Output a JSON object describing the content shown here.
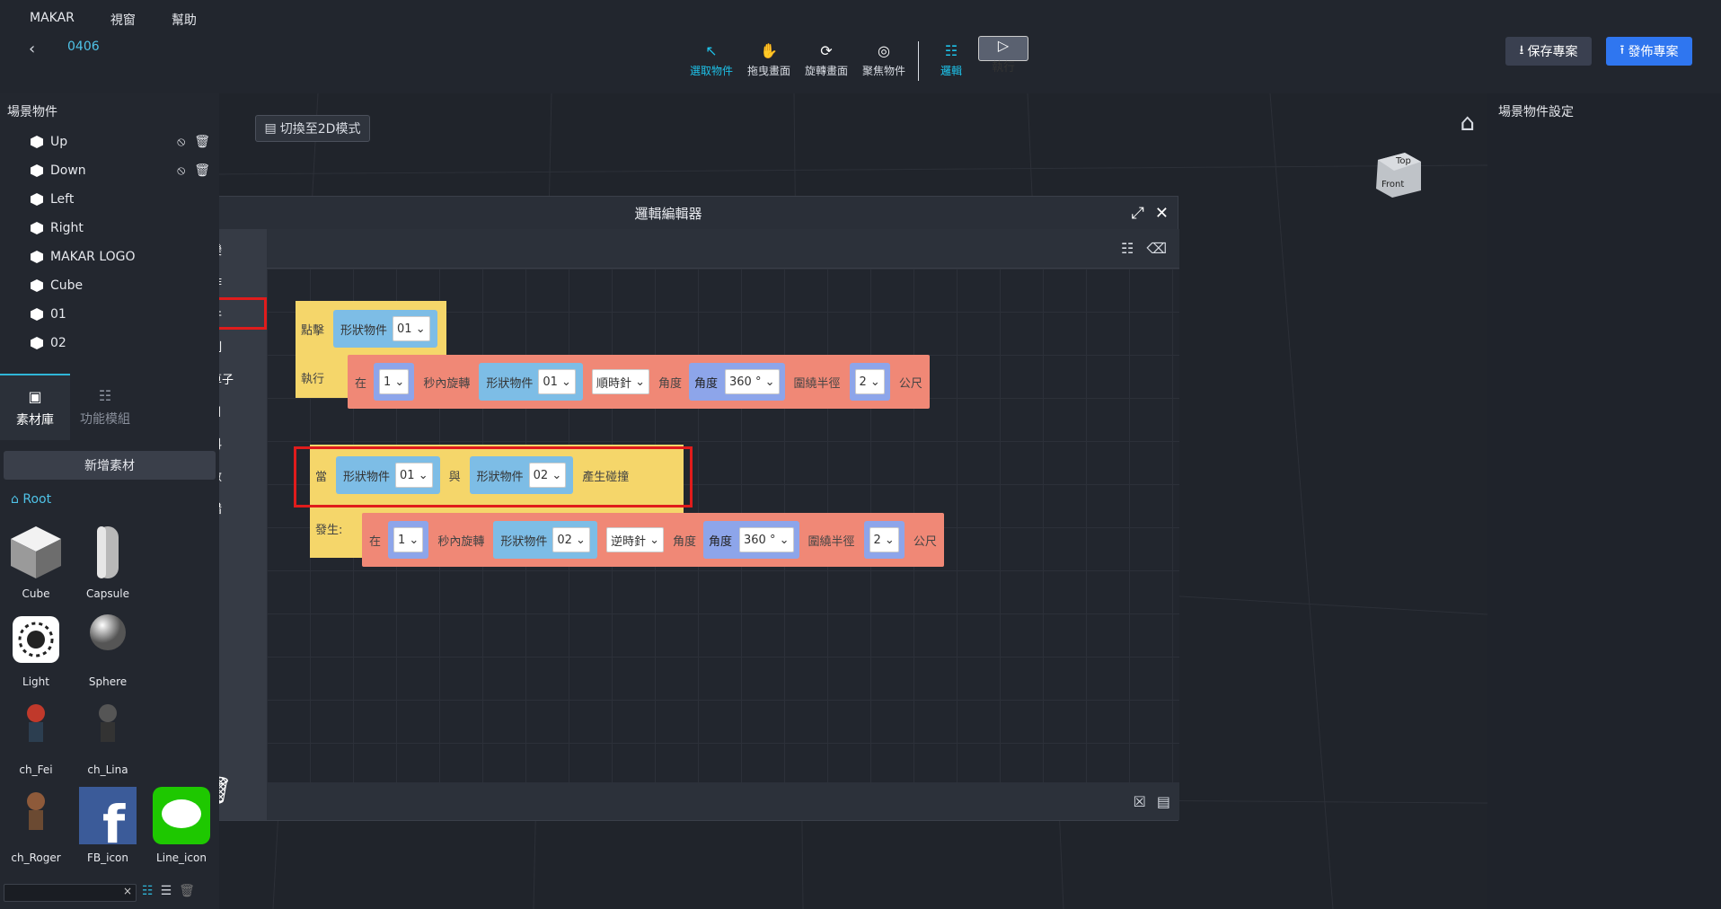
{
  "menu": [
    "MAKAR",
    "視窗",
    "幫助"
  ],
  "project": {
    "name": "0406"
  },
  "toolbar": {
    "select": "選取物件",
    "drag": "拖曳畫面",
    "rotate": "旋轉畫面",
    "focus": "聚焦物件",
    "logic": "邏輯",
    "run": "執行",
    "save": "保存專案",
    "publish": "發佈專案"
  },
  "scene": {
    "title": "場景物件",
    "objects": [
      "Up",
      "Down",
      "Left",
      "Right",
      "MAKAR LOGO",
      "Cube",
      "01",
      "02"
    ]
  },
  "tabs": {
    "library": "素材庫",
    "modules": "功能模組"
  },
  "assets_panel": {
    "add": "新增素材",
    "root": "Root",
    "items": [
      "Cube",
      "Capsule",
      "Light",
      "Sphere",
      "ch_Fei",
      "ch_Lina",
      "ch_Roger",
      "FB_icon",
      "Line_icon"
    ]
  },
  "search": {
    "clear": "×"
  },
  "right_panel": {
    "title": "場景物件設定"
  },
  "viewport": {
    "mode2d": "切換至2D模式",
    "cube_top": "Top",
    "cube_front": "Front"
  },
  "editor": {
    "title": "邏輯編輯器",
    "categories": [
      {
        "label": "轉變",
        "color": "#f08876"
      },
      {
        "label": "動作",
        "color": "#f5b26b"
      },
      {
        "label": "事件",
        "color": "#f5d66a"
      },
      {
        "label": "控制",
        "color": "#b5cf6b"
      },
      {
        "label": "運算子",
        "color": "#7fcbb8"
      },
      {
        "label": "項目",
        "color": "#84c7ee"
      },
      {
        "label": "資料",
        "color": "#8da5ea"
      },
      {
        "label": "變數",
        "color": "#9b90e6"
      },
      {
        "label": "除錯",
        "color": "#a57ed9"
      }
    ],
    "block1": {
      "hat": "點擊",
      "shape": "形狀物件",
      "obj": "01",
      "do": "執行",
      "in": "在",
      "sec": "1",
      "rot": "秒內旋轉",
      "shape2": "形狀物件",
      "obj2": "01",
      "dir": "順時針",
      "angle_lbl": "角度",
      "angle_lbl2": "角度",
      "angle": "360 °",
      "radius_lbl": "圍繞半徑",
      "radius": "2",
      "unit": "公尺"
    },
    "block2": {
      "hat": "當",
      "shape": "形狀物件",
      "obj": "01",
      "and": "與",
      "shape2": "形狀物件",
      "obj2": "02",
      "collide": "產生碰撞",
      "do": "發生:",
      "in": "在",
      "sec": "1",
      "rot": "秒內旋轉",
      "shape3": "形狀物件",
      "obj3": "02",
      "dir": "逆時針",
      "angle_lbl": "角度",
      "angle_lbl2": "角度",
      "angle": "360 °",
      "radius_lbl": "圍繞半徑",
      "radius": "2",
      "unit": "公尺"
    }
  }
}
